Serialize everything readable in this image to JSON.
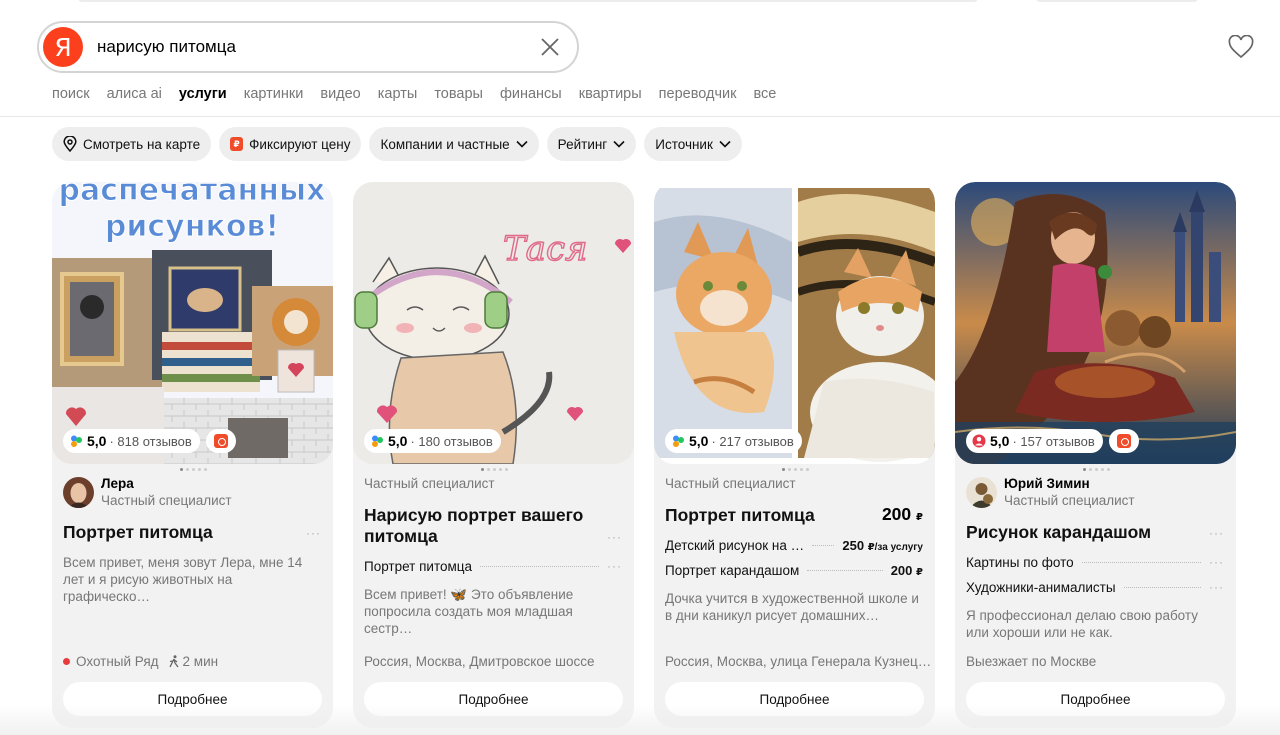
{
  "search": {
    "query": "нарисую питомца"
  },
  "nav": {
    "tabs": [
      "поиск",
      "алиса ai",
      "услуги",
      "картинки",
      "видео",
      "карты",
      "товары",
      "финансы",
      "квартиры",
      "переводчик",
      "все"
    ],
    "active": "услуги"
  },
  "logo": {
    "letter": "Я"
  },
  "filters": {
    "map": "Смотреть на карте",
    "fixed_price": "Фиксируют цену",
    "companies": "Компании и частные",
    "rating": "Рейтинг",
    "source": "Источник"
  },
  "cards": [
    {
      "rating": "5,0",
      "reviews": "· 818 отзывов",
      "author": "Лера",
      "author_type": "Частный специалист",
      "title": "Портрет питомца",
      "description": "Всем привет, меня зовут Лера, мне 14 лет и я рисую животных на графическо…",
      "metro": "Охотный Ряд",
      "walk": "2 мин",
      "button": "Подробнее",
      "image_text": "распечатанных рисунков!"
    },
    {
      "rating": "5,0",
      "reviews": "· 180 отзывов",
      "author_type": "Частный специалист",
      "title_line1": "Нарисую портрет вашего",
      "title_line2": "питомца",
      "service": "Портрет питомца",
      "description": "Всем привет! 🦋 Это объявление попросила создать моя младшая сестр…",
      "location": "Россия, Москва, Дмитровское шоссе",
      "button": "Подробнее",
      "image_text": "Тася"
    },
    {
      "rating": "5,0",
      "reviews": "· 217 отзывов",
      "author_type": "Частный специалист",
      "title": "Портрет питомца",
      "price": "200",
      "currency": "₽",
      "services": [
        {
          "name": "Детский рисунок на …",
          "price": "250",
          "unit": "₽/за услугу"
        },
        {
          "name": "Портрет карандашом",
          "price": "200",
          "unit": "₽"
        }
      ],
      "description": "Дочка учится в художественной школе и в дни каникул рисует домашних…",
      "location": "Россия, Москва, улица Генерала Кузнец…",
      "button": "Подробнее"
    },
    {
      "rating": "5,0",
      "reviews": "· 157 отзывов",
      "author": "Юрий Зимин",
      "author_type": "Частный специалист",
      "title": "Рисунок карандашом",
      "services": [
        "Картины по фото",
        "Художники-анималисты"
      ],
      "description": "Я профессионал делаю свою работу или хороши или не как.",
      "location": "Выезжает по Москве",
      "button": "Подробнее"
    }
  ],
  "colors": {
    "accent": "#fc3f1d",
    "chip_bg": "#eeeeee",
    "card_bg": "#f2f2f2",
    "muted_text": "#777777"
  }
}
